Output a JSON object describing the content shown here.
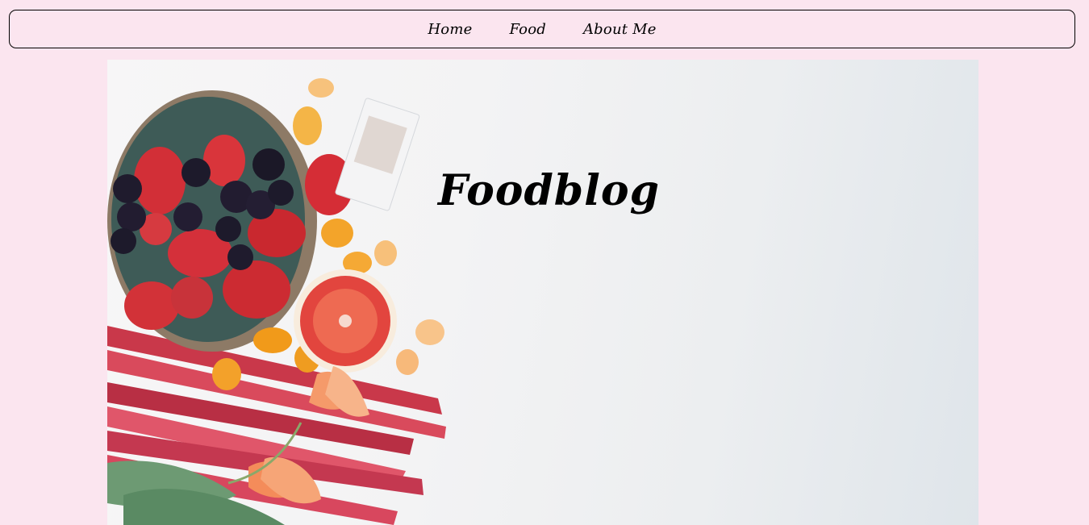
{
  "nav": {
    "items": [
      {
        "label": "Home"
      },
      {
        "label": "Food"
      },
      {
        "label": "About Me"
      }
    ]
  },
  "hero": {
    "title": "Foodblog"
  },
  "colors": {
    "page_background": "#fbe5ef",
    "nav_border": "#000000",
    "text": "#000000"
  }
}
